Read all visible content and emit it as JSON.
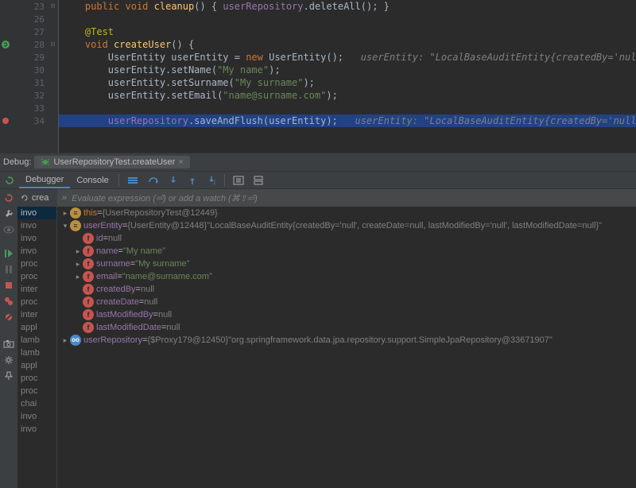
{
  "editor": {
    "lines": [
      {
        "n": 23,
        "icons": [],
        "fold": "-",
        "html": "    <span class='kw'>public</span> <span class='kw'>void</span> <span class='call'>cleanup</span>() { <span class='field'>userRepository</span>.deleteAll(); }"
      },
      {
        "n": 26,
        "icons": [],
        "fold": "",
        "html": ""
      },
      {
        "n": 27,
        "icons": [],
        "fold": "",
        "html": "    <span class='ann'>@Test</span>"
      },
      {
        "n": 28,
        "icons": [
          "run-green"
        ],
        "fold": "-",
        "html": "    <span class='kw'>void</span> <span class='call'>createUser</span>() {"
      },
      {
        "n": 29,
        "icons": [],
        "fold": "",
        "html": "        UserEntity userEntity = <span class='kw'>new</span> UserEntity();   <span class='comment'>userEntity: \"LocalBaseAuditEntity{createdBy='null', createDa</span>"
      },
      {
        "n": 30,
        "icons": [],
        "fold": "",
        "html": "        userEntity.setName(<span class='str'>\"My name\"</span>);"
      },
      {
        "n": 31,
        "icons": [],
        "fold": "",
        "html": "        userEntity.setSurname(<span class='str'>\"My surname\"</span>);"
      },
      {
        "n": 32,
        "icons": [],
        "fold": "",
        "html": "        userEntity.setEmail(<span class='str'>\"name@surname.com\"</span>);"
      },
      {
        "n": 33,
        "icons": [],
        "fold": "",
        "html": "",
        "caret": true
      },
      {
        "n": 34,
        "icons": [
          "breakpoint"
        ],
        "fold": "",
        "html": "        <span class='field'>userRepository</span>.saveAndFlush(userEntity);   <span class='comment'>userEntity: \"LocalBaseAuditEntity{createdBy='null', createDa</span>",
        "hl": true
      }
    ]
  },
  "debug": {
    "label": "Debug:",
    "tabTitle": "UserRepositoryTest.createUser",
    "tabs": {
      "debugger": "Debugger",
      "console": "Console"
    }
  },
  "watch": {
    "placeholder": "Evaluate expression (⏎) or add a watch (⌘⇧⏎)"
  },
  "frames": {
    "header": "crea",
    "items": [
      "invo",
      "invo",
      "invo",
      "invo",
      "proc",
      "proc",
      "inter",
      "proc",
      "inter",
      "appl",
      "lamb",
      "lamb",
      "appl",
      "proc",
      "proc",
      "chai",
      "invo",
      "invo"
    ]
  },
  "vars": [
    {
      "depth": 0,
      "arrow": ">",
      "icon": "obj",
      "glyph": "≡",
      "nameClass": "this",
      "name": "this",
      "eq": " = ",
      "val": "{UserRepositoryTest@12449}"
    },
    {
      "depth": 0,
      "arrow": "v",
      "icon": "obj",
      "glyph": "≡",
      "name": "userEntity",
      "eq": " = ",
      "val": "{UserEntity@12448}",
      "tail": " \"LocalBaseAuditEntity{createdBy='null', createDate=null, lastModifiedBy='null', lastModifiedDate=null}\""
    },
    {
      "depth": 1,
      "arrow": "",
      "icon": "fld",
      "glyph": "f",
      "name": "id",
      "eq": " = ",
      "val": "null"
    },
    {
      "depth": 1,
      "arrow": ">",
      "icon": "fld",
      "glyph": "f",
      "name": "name",
      "eq": " = ",
      "str": "\"My name\""
    },
    {
      "depth": 1,
      "arrow": ">",
      "icon": "fld",
      "glyph": "f",
      "name": "surname",
      "eq": " = ",
      "str": "\"My surname\""
    },
    {
      "depth": 1,
      "arrow": ">",
      "icon": "fld",
      "glyph": "f",
      "name": "email",
      "eq": " = ",
      "str": "\"name@surname.com\""
    },
    {
      "depth": 1,
      "arrow": "",
      "icon": "fld",
      "glyph": "f",
      "name": "createdBy",
      "eq": " = ",
      "val": "null"
    },
    {
      "depth": 1,
      "arrow": "",
      "icon": "fld",
      "glyph": "f",
      "name": "createDate",
      "eq": " = ",
      "val": "null"
    },
    {
      "depth": 1,
      "arrow": "",
      "icon": "fld",
      "glyph": "f",
      "name": "lastModifiedBy",
      "eq": " = ",
      "val": "null"
    },
    {
      "depth": 1,
      "arrow": "",
      "icon": "fld",
      "glyph": "f",
      "name": "lastModifiedDate",
      "eq": " = ",
      "val": "null"
    },
    {
      "depth": 0,
      "arrow": ">",
      "icon": "inf",
      "glyph": "oo",
      "name": "userRepository",
      "eq": " = ",
      "val": "{$Proxy179@12450}",
      "tail": " \"org.springframework.data.jpa.repository.support.SimpleJpaRepository@33671907\""
    }
  ]
}
